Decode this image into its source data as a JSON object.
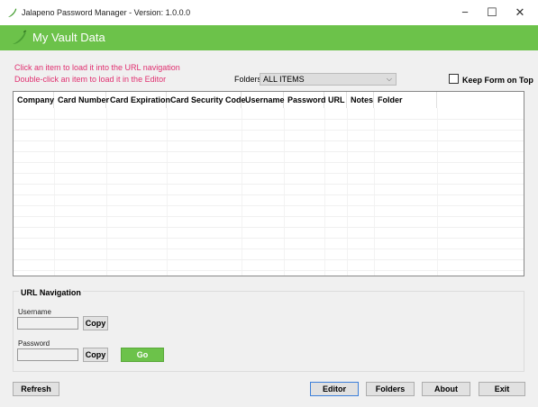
{
  "window": {
    "title": "Jalapeno Password Manager -  Version: 1.0.0.0",
    "minimize": "−",
    "maximize": "☐",
    "close": "✕"
  },
  "header": {
    "title": "My Vault Data",
    "accent": "#6cc24a"
  },
  "hints": {
    "line1": "Click an item to load it into the URL navigation",
    "line2": "Double-click an item to load it in the Editor",
    "color": "#e03070"
  },
  "folders": {
    "label": "Folders",
    "selected": "ALL ITEMS"
  },
  "keep_on_top": {
    "label": "Keep Form on Top",
    "checked": false
  },
  "table": {
    "columns": [
      "Company",
      "Card Number",
      "Card Expiration",
      "Card Security Code",
      "Username",
      "Password",
      "URL",
      "Notes",
      "Folder"
    ]
  },
  "url_navigation": {
    "legend": "URL Navigation",
    "username_label": "Username",
    "username_value": "",
    "password_label": "Password",
    "password_value": "",
    "copy_label": "Copy",
    "go_label": "Go"
  },
  "footer": {
    "refresh": "Refresh",
    "editor": "Editor",
    "folders": "Folders",
    "about": "About",
    "exit": "Exit"
  }
}
